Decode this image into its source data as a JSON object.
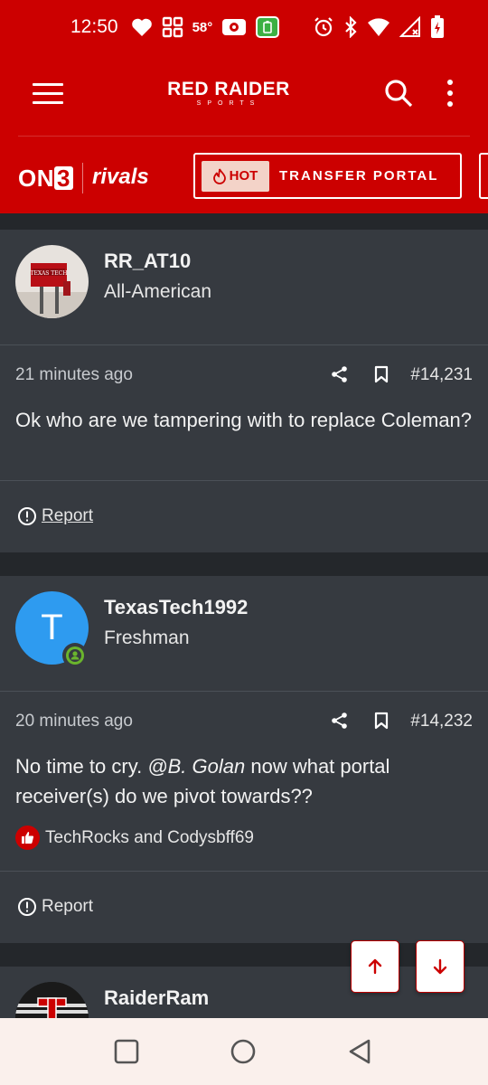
{
  "status_bar": {
    "time": "12:50",
    "temperature": "58°",
    "icons_left": [
      "heart-icon",
      "widgets-icon",
      "weather-text",
      "radio-icon",
      "battery-saver-icon"
    ],
    "icons_right": [
      "alarm-icon",
      "bluetooth-icon",
      "wifi-icon",
      "signal-icon",
      "battery-charging-icon"
    ]
  },
  "app_bar": {
    "brand_main": "RED RAIDER",
    "brand_sub": "SPORTS",
    "on3_label": "ON",
    "on3_digit": "3",
    "rivals_label": "rivals",
    "hot_label": "HOT",
    "portal_label": "TRANSFER PORTAL",
    "accent": "#cc0000"
  },
  "posts": [
    {
      "username": "RR_AT10",
      "rank": "All-American",
      "time_ago": "21 minutes ago",
      "post_number": "#14,231",
      "body": "Ok who are we tampering with to replace Coleman?",
      "report_label": "Report"
    },
    {
      "username": "TexasTech1992",
      "rank": "Freshman",
      "avatar_letter": "T",
      "avatar_color": "#2e9bf0",
      "time_ago": "20 minutes ago",
      "post_number": "#14,232",
      "body_pre": "No time to cry. ",
      "body_mention": "@B. Golan",
      "body_post": " now what portal receiver(s) do we pivot towards??",
      "reactions": "TechRocks and Codysbff69",
      "report_label": "Report"
    },
    {
      "username": "RaiderRam"
    }
  ],
  "colors": {
    "post_bg": "#363a40",
    "feed_bg": "#24272b",
    "accent_red": "#cc0000"
  }
}
